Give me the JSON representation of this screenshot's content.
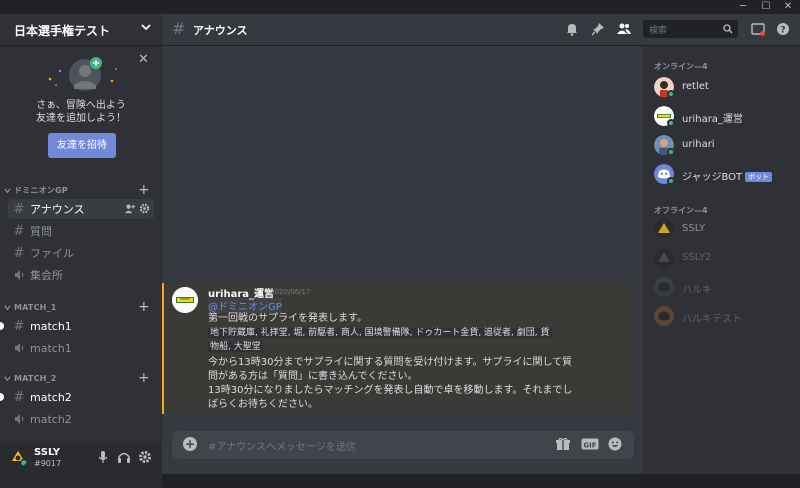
{
  "window": {
    "min": "─",
    "max": "☐",
    "close": "✕"
  },
  "server": {
    "name": "日本選手権テスト"
  },
  "invite": {
    "line1": "さぁ、冒険へ出よう",
    "line2": "友達を追加しよう！",
    "button": "友達を招待"
  },
  "categories": [
    {
      "name": "ドミニオンGP",
      "channels": [
        {
          "type": "text",
          "label": "アナウンス",
          "active": true
        },
        {
          "type": "text",
          "label": "質問"
        },
        {
          "type": "text",
          "label": "ファイル"
        },
        {
          "type": "voice",
          "label": "集会所"
        }
      ]
    },
    {
      "name": "MATCH_1",
      "channels": [
        {
          "type": "text",
          "label": "match1",
          "unread": true
        },
        {
          "type": "voice",
          "label": "match1"
        }
      ]
    },
    {
      "name": "MATCH_2",
      "channels": [
        {
          "type": "text",
          "label": "match2",
          "unread": true
        },
        {
          "type": "voice",
          "label": "match2"
        }
      ]
    }
  ],
  "user": {
    "name": "SSLY",
    "tag": "#9017"
  },
  "header": {
    "channel": "アナウンス",
    "search_placeholder": "検索"
  },
  "message": {
    "author": "urihara_運営",
    "time": "2020/06/17",
    "mention": "@ドミニオンGP",
    "line1": "第一回戦のサプライを発表します。",
    "code1": "地下貯蔵庫, 礼拝堂, 堀, 前駆者, 商人, 国境警備隊, ドゥカート金貨, 追従者, 劇団, 貨",
    "code2": "物船, 大聖堂",
    "line2": "今から13時30分までサプライに関する質問を受け付けます。サプライに関して質",
    "line3": "問がある方は「質問」に書き込んでください。",
    "line4": "13時30分になりましたらマッチングを発表し自動で卓を移動します。それまでし",
    "line5": "ばらくお待ちください。"
  },
  "composer": {
    "placeholder": "#アナウンスへメッセージを送信"
  },
  "members": {
    "online_head": "オンライン—4",
    "offline_head": "オフライン—4",
    "online": [
      {
        "name": "retlet"
      },
      {
        "name": "urihara_運営"
      },
      {
        "name": "urihari"
      },
      {
        "name": "ジャッジBOT",
        "badge": "ボット"
      }
    ],
    "offline": [
      {
        "name": "SSLY"
      },
      {
        "name": "SSLY2"
      },
      {
        "name": "ハルキ"
      },
      {
        "name": "ハルキテスト"
      }
    ]
  },
  "colors": {
    "accent": "#7289da",
    "online": "#43b581",
    "mention_bar": "#faa61a"
  }
}
